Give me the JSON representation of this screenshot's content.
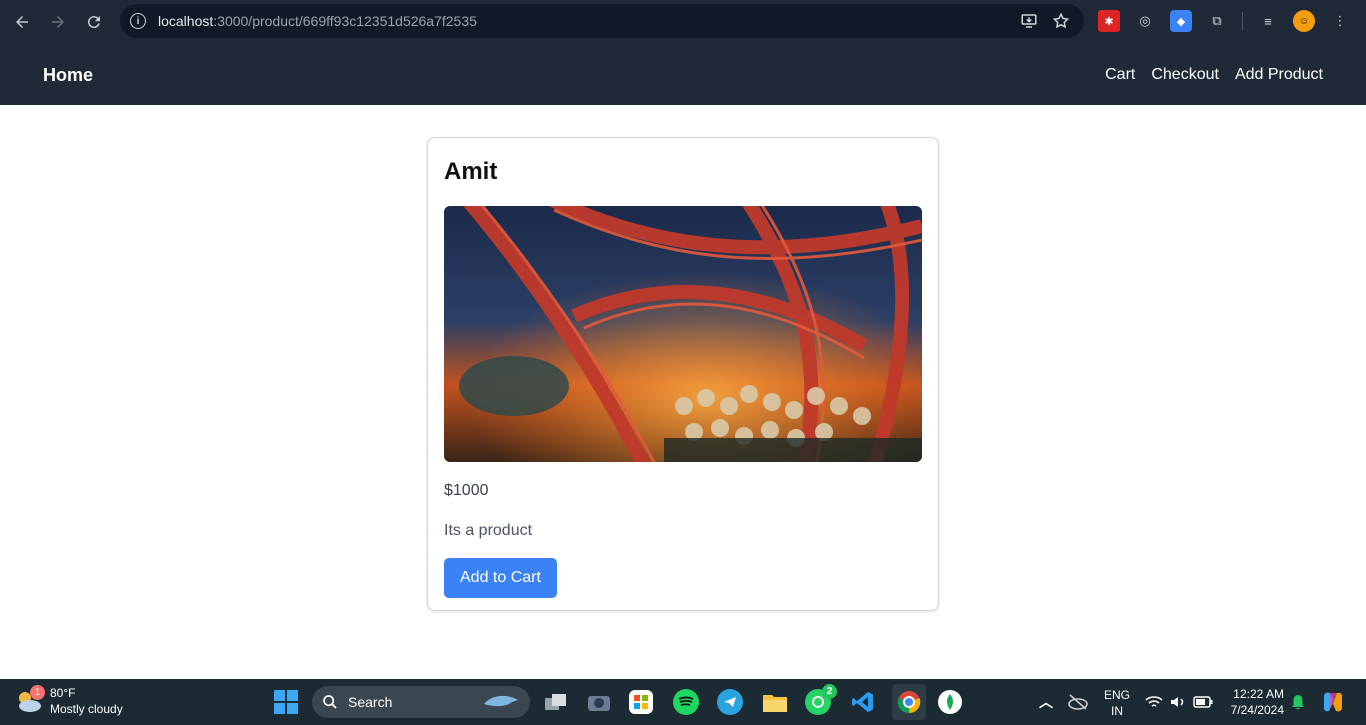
{
  "browser": {
    "url_host": "localhost",
    "url_path": ":3000/product/669ff93c12351d526a7f2535"
  },
  "navbar": {
    "brand": "Home",
    "links": [
      "Cart",
      "Checkout",
      "Add Product"
    ]
  },
  "product": {
    "title": "Amit",
    "image_alt": "Roller coaster with riders",
    "price": "$1000",
    "description": "Its a product",
    "add_button": "Add to Cart"
  },
  "taskbar": {
    "weather_temp": "80°F",
    "weather_desc": "Mostly cloudy",
    "weather_badge": "1",
    "search_label": "Search",
    "whatsapp_badge": "2",
    "lang_top": "ENG",
    "lang_bottom": "IN",
    "time": "12:22 AM",
    "date": "7/24/2024"
  },
  "colors": {
    "nav_bg": "#1f2937",
    "button": "#3b82f6",
    "taskbar_bg": "#1c2a33"
  }
}
